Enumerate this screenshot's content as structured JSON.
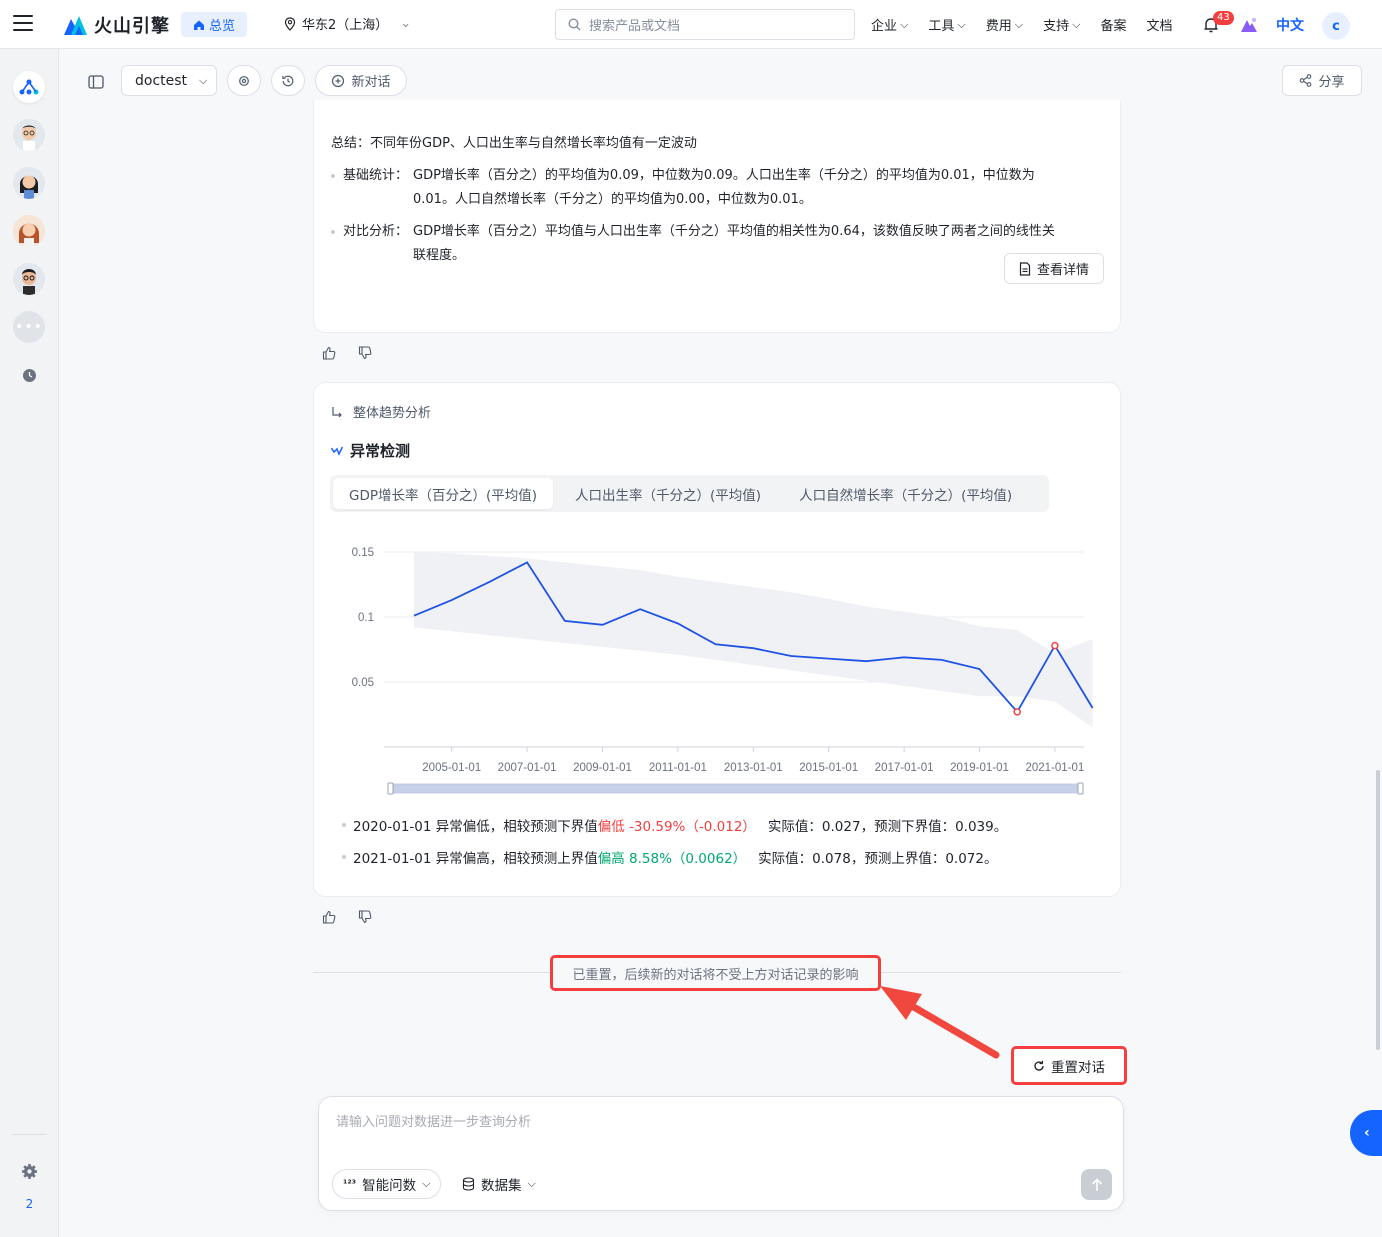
{
  "topbar": {
    "logo_text": "火山引擎",
    "home_label": "总览",
    "region": "华东2（上海）",
    "search_placeholder": "搜索产品或文档",
    "nav": [
      "企业",
      "工具",
      "费用",
      "支持"
    ],
    "nav_plain": [
      "备案",
      "文档"
    ],
    "notification_count": "43",
    "lang": "中文",
    "user_initial": "c"
  },
  "sidebar": {
    "bottom_number": "2"
  },
  "subbar": {
    "project": "doctest",
    "new_chat": "新对话",
    "share": "分享"
  },
  "summary_card": {
    "summary": "总结：不同年份GDP、人口出生率与自然增长率均值有一定波动",
    "items": [
      {
        "label": "基础统计：",
        "line1": "GDP增长率（百分之）的平均值为0.09，中位数为0.09。人口出生率（千分之）的平均值为0.01，中位数为",
        "line2": "0.01。人口自然增长率（千分之）的平均值为0.00，中位数为0.01。"
      },
      {
        "label": "对比分析：",
        "line1": "GDP增长率（百分之）平均值与人口出生率（千分之）平均值的相关性为0.64，该数值反映了两者之间的线性关",
        "line2": "联程度。"
      }
    ],
    "detail_button": "查看详情"
  },
  "anomaly_card": {
    "parent_step": "整体趋势分析",
    "title": "异常检测",
    "tabs": [
      "GDP增长率（百分之）(平均值)",
      "人口出生率（千分之）(平均值)",
      "人口自然增长率（千分之）(平均值)"
    ],
    "active_tab": 0,
    "results": [
      {
        "prefix": "2020-01-01 异常偏低，相较预测下界值",
        "tag": "偏低 -30.59%（-0.012）",
        "suffix": "实际值：0.027，预测下界值：0.039。"
      },
      {
        "prefix": "2021-01-01 异常偏高，相较预测上界值",
        "tag": "偏高 8.58%（0.0062）",
        "suffix": "实际值：0.078，预测上界值：0.072。"
      }
    ]
  },
  "chart_data": {
    "type": "line",
    "x": [
      "2004-01-01",
      "2005-01-01",
      "2006-01-01",
      "2007-01-01",
      "2008-01-01",
      "2009-01-01",
      "2010-01-01",
      "2011-01-01",
      "2012-01-01",
      "2013-01-01",
      "2014-01-01",
      "2015-01-01",
      "2016-01-01",
      "2017-01-01",
      "2018-01-01",
      "2019-01-01",
      "2020-01-01",
      "2021-01-01",
      "2022-01-01"
    ],
    "x_tick_labels": [
      "2005-01-01",
      "2007-01-01",
      "2009-01-01",
      "2011-01-01",
      "2013-01-01",
      "2015-01-01",
      "2017-01-01",
      "2019-01-01",
      "2021-01-01"
    ],
    "series": [
      {
        "values": [
          0.101,
          0.113,
          0.127,
          0.142,
          0.097,
          0.094,
          0.106,
          0.095,
          0.079,
          0.076,
          0.07,
          0.068,
          0.066,
          0.069,
          0.067,
          0.06,
          0.027,
          0.078,
          0.03
        ],
        "color": "#1f52e6"
      }
    ],
    "band_upper": [
      0.15,
      0.149,
      0.147,
      0.145,
      0.142,
      0.139,
      0.136,
      0.131,
      0.127,
      0.123,
      0.119,
      0.114,
      0.108,
      0.104,
      0.1,
      0.093,
      0.09,
      0.072,
      0.083
    ],
    "band_lower": [
      0.092,
      0.089,
      0.086,
      0.083,
      0.08,
      0.077,
      0.074,
      0.071,
      0.067,
      0.063,
      0.059,
      0.055,
      0.051,
      0.047,
      0.043,
      0.039,
      0.039,
      0.035,
      0.015
    ],
    "anomalies": [
      {
        "x": "2020-01-01",
        "y": 0.027
      },
      {
        "x": "2021-01-01",
        "y": 0.078
      }
    ],
    "y_ticks": [
      0.05,
      0.1,
      0.15
    ],
    "y_tick_labels": [
      "0.05",
      "0.1",
      "0.15"
    ],
    "ylim": [
      0,
      0.16
    ],
    "grid": true
  },
  "feedback_gap_notice": "已重置，后续新的对话将不受上方对话记录的影响",
  "reset_button": "重置对话",
  "input": {
    "placeholder": "请输入问题对数据进一步查询分析",
    "mode": "智能问数",
    "dataset": "数据集"
  }
}
